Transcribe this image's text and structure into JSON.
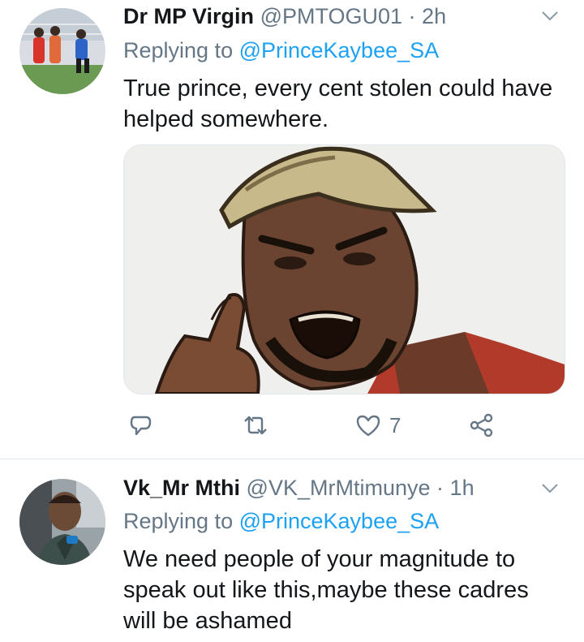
{
  "tweets": [
    {
      "name": "Dr MP Virgin",
      "handle": "@PMTOGU01",
      "separator": "·",
      "time": "2h",
      "replying_prefix": "Replying to ",
      "replying_to": "@PrinceKaybee_SA",
      "text_lines": [
        "True prince, every cent stolen could have",
        "helped somewhere."
      ],
      "like_count": "7"
    },
    {
      "name": "Vk_Mr Mthi",
      "handle": "@VK_MrMtimunye",
      "separator": "·",
      "time": "1h",
      "replying_prefix": "Replying to ",
      "replying_to": "@PrinceKaybee_SA",
      "text_lines": [
        "We need people of your magnitude to",
        "speak out like this,maybe these cadres",
        "will be ashamed"
      ]
    }
  ],
  "icons": [
    "reply-icon",
    "retweet-icon",
    "like-icon",
    "share-icon",
    "chevron-down-icon"
  ],
  "colors": {
    "accent": "#1da1f2",
    "secondary_text": "#657786",
    "primary_text": "#14171a",
    "divider": "#e1e8ed"
  }
}
